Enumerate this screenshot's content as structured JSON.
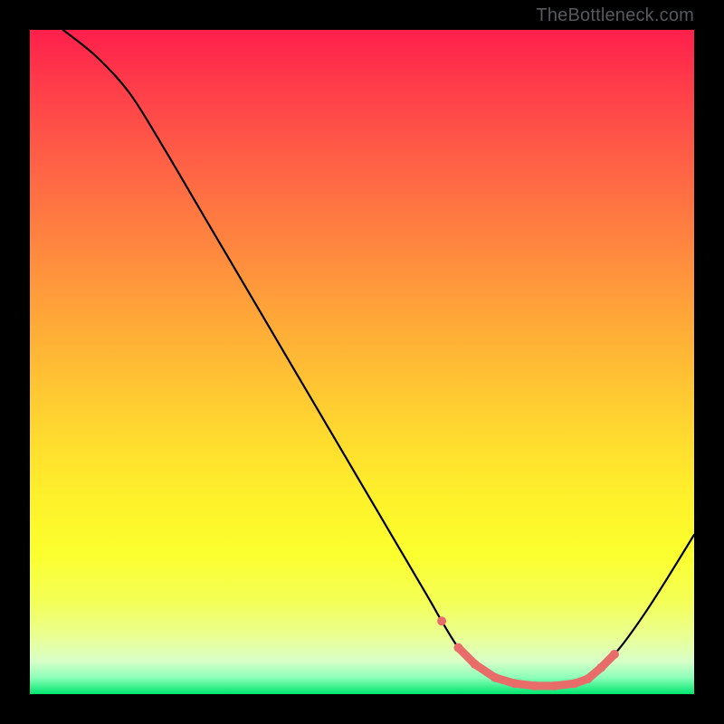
{
  "attribution": "TheBottleneck.com",
  "chart_data": {
    "type": "line",
    "title": "",
    "xlabel": "",
    "ylabel": "",
    "xlim": [
      0,
      100
    ],
    "ylim": [
      0,
      100
    ],
    "x": [
      5,
      10,
      15,
      20,
      25,
      30,
      35,
      40,
      45,
      50,
      55,
      60,
      62,
      64.5,
      67,
      70,
      73,
      76,
      79,
      82,
      84,
      86,
      88,
      90,
      93,
      96,
      100
    ],
    "y": [
      100,
      96,
      90.5,
      82.5,
      74,
      65.5,
      57,
      48.5,
      40,
      31.5,
      23,
      14.5,
      11,
      7,
      4.5,
      2.5,
      1.6,
      1.25,
      1.25,
      1.6,
      2.3,
      4,
      6,
      8.5,
      12.8,
      17.5,
      24
    ],
    "dotted": {
      "x": [
        62,
        64.5,
        67,
        70,
        73,
        76,
        79,
        82,
        84,
        86,
        88
      ],
      "y": [
        11,
        7,
        4.5,
        2.5,
        1.6,
        1.25,
        1.25,
        1.6,
        2.3,
        4,
        6
      ]
    },
    "colors": {
      "line": "#000000",
      "dots": "#e86d6a"
    }
  }
}
